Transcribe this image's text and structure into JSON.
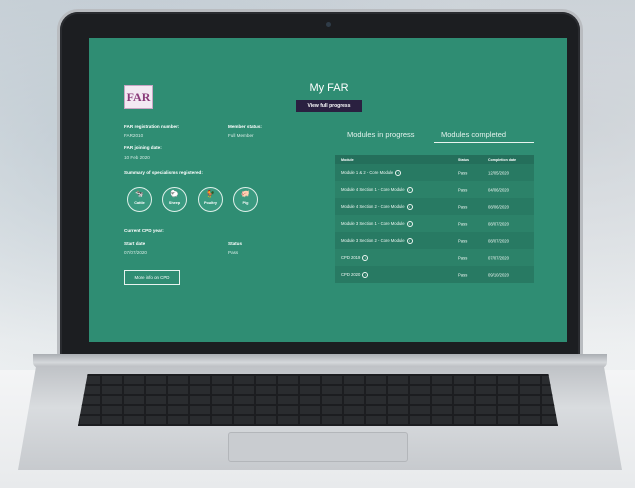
{
  "page": {
    "title": "My FAR",
    "logo_text": "FAR",
    "view_progress_label": "View full progress"
  },
  "member": {
    "reg_number_label": "FAR registration number:",
    "reg_number": "FAR2010",
    "status_label": "Member status:",
    "status": "Full Member",
    "joining_label": "FAR joining date:",
    "joining_date": "10 Feb 2020",
    "specialisms_label": "Summary of specialisms registered:"
  },
  "specialisms": [
    {
      "name": "Cattle",
      "icon": "cattle-icon",
      "glyph": "🐄"
    },
    {
      "name": "Sheep",
      "icon": "sheep-icon",
      "glyph": "🐑"
    },
    {
      "name": "Poultry",
      "icon": "poultry-icon",
      "glyph": "🐓"
    },
    {
      "name": "Pig",
      "icon": "pig-icon",
      "glyph": "🐖"
    }
  ],
  "cpd": {
    "heading": "Current CPD year:",
    "start_label": "Start date",
    "start_date": "07/07/2020",
    "status_label": "Status",
    "status": "Pass",
    "more_info_label": "More info on CPD"
  },
  "tabs": {
    "in_progress": "Modules in progress",
    "completed": "Modules completed",
    "active": "completed"
  },
  "table": {
    "headers": [
      "Module",
      "Status",
      "Completion date"
    ],
    "rows": [
      {
        "module": "Module 1 & 2 - Core Module",
        "status": "Pass",
        "date": "12/05/2020"
      },
      {
        "module": "Module 4 Section 1 - Core Module",
        "status": "Pass",
        "date": "04/06/2020"
      },
      {
        "module": "Module 4 Section 2 - Core Module",
        "status": "Pass",
        "date": "08/06/2020"
      },
      {
        "module": "Module 3 Section 1 - Core Module",
        "status": "Pass",
        "date": "08/07/2020"
      },
      {
        "module": "Module 3 Section 2 - Core Module",
        "status": "Pass",
        "date": "08/07/2020"
      },
      {
        "module": "CPD 2019",
        "status": "Pass",
        "date": "07/07/2020"
      },
      {
        "module": "CPD 2020",
        "status": "Pass",
        "date": "09/10/2020"
      }
    ]
  },
  "colors": {
    "screen_bg": "#2f8d73",
    "button_dark": "#2a2040"
  }
}
